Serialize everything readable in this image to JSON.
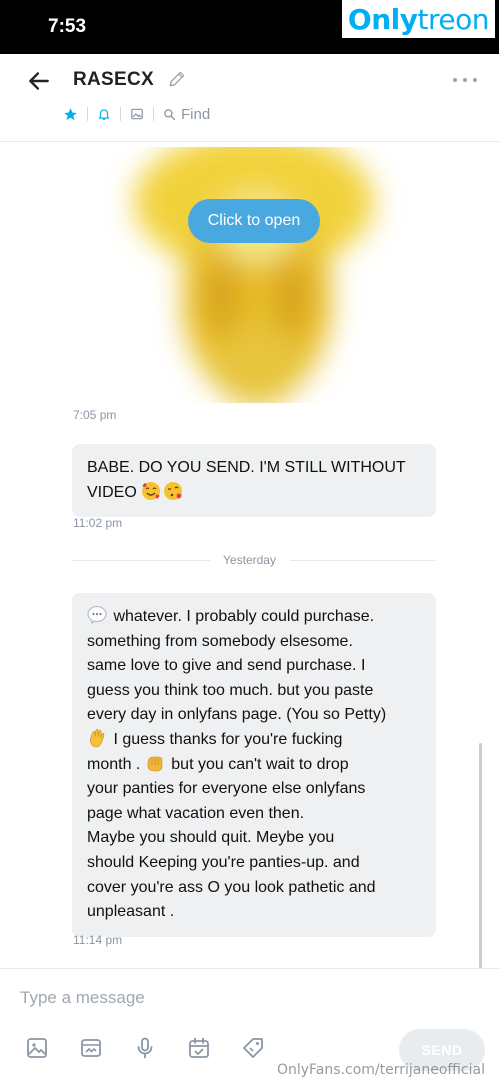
{
  "status_bar": {
    "time": "7:53"
  },
  "watermark": {
    "brand_a": "Only",
    "brand_b": "treon",
    "footer": "OnlyFans.com/terrijaneofficial"
  },
  "header": {
    "chat_name": "RASECX",
    "find_label": "Find",
    "icons": [
      "back-arrow-icon",
      "pencil-icon",
      "more-icon",
      "star-icon",
      "bell-icon",
      "image-icon",
      "search-icon"
    ]
  },
  "media": {
    "open_label": "Click to open",
    "time": "7:05 pm"
  },
  "messages": [
    {
      "text": "BABE. DO YOU SEND. I'M STILL WITHOUT VIDEO",
      "time": "11:02 pm"
    },
    {
      "lines": [
        "whatever. I probably could purchase.",
        "something from somebody elsesome.",
        "same love to give and send purchase. I",
        "guess you think too much. but you paste",
        "every day in onlyfans page. (You so Petty)",
        "I guess thanks for you're fucking",
        "month .",
        "but you can't wait to drop",
        "your panties for everyone else onlyfans",
        "page what vacation even then.",
        "Maybe you should quit. Meybe you",
        "should Keeping you're panties-up. and",
        "cover you're ass O you look pathetic and",
        "unpleasant ."
      ],
      "time": "11:14 pm"
    }
  ],
  "divider": "Yesterday",
  "composer": {
    "placeholder": "Type a message",
    "send_label": "SEND",
    "icons": [
      "image-icon",
      "media-vault-icon",
      "microphone-icon",
      "calendar-icon",
      "price-tag-icon"
    ]
  },
  "colors": {
    "accent": "#00aff0",
    "open_button": "#4aa8e0",
    "bubble": "#eef0f2",
    "muted": "#8a96a3"
  }
}
